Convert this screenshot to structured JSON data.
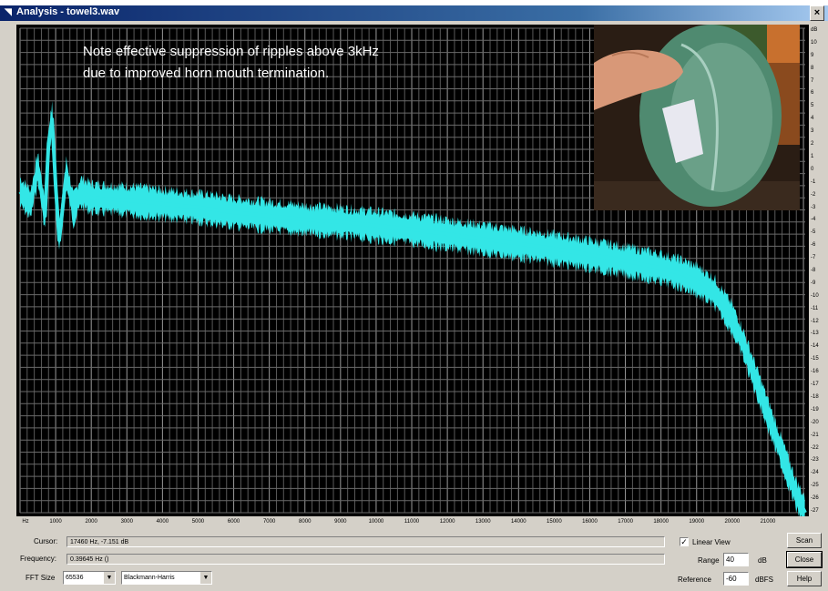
{
  "window": {
    "title": "Analysis - towel3.wav",
    "close_label": "×"
  },
  "annotation": {
    "line1": "Note effective suppression of ripples above 3kHz",
    "line2": "due to improved horn mouth termination."
  },
  "chart_data": {
    "type": "line",
    "xlabel": "",
    "ylabel": "dB",
    "xlim": [
      0,
      22050
    ],
    "ylim": [
      -28,
      12
    ],
    "grid": true,
    "x_ticks": [
      "Hz",
      "1000",
      "2000",
      "3000",
      "4000",
      "5000",
      "6000",
      "7000",
      "8000",
      "9000",
      "10000",
      "11000",
      "12000",
      "13000",
      "14000",
      "15000",
      "16000",
      "17000",
      "18000",
      "19000",
      "20000",
      "21000"
    ],
    "y_ticks": [
      "dB",
      "10",
      "9",
      "8",
      "7",
      "6",
      "5",
      "4",
      "3",
      "2",
      "1",
      "0",
      "-1",
      "-2",
      "-3",
      "-4",
      "-5",
      "-6",
      "-7",
      "-8",
      "-9",
      "-10",
      "-11",
      "-12",
      "-13",
      "-14",
      "-15",
      "-16",
      "-17",
      "-18",
      "-19",
      "-20",
      "-21",
      "-22",
      "-23",
      "-24",
      "-25",
      "-26",
      "-27"
    ],
    "series": [
      {
        "color": "#33e6e6",
        "x": [
          0,
          300,
          500,
          700,
          800,
          900,
          1000,
          1100,
          1300,
          1500,
          1700,
          2000,
          3000,
          4000,
          5000,
          6000,
          7000,
          8000,
          9000,
          10000,
          11000,
          12000,
          13000,
          14000,
          15000,
          16000,
          17000,
          18000,
          18500,
          19000,
          19500,
          20000,
          20300,
          20600,
          20900,
          21200,
          21500,
          21800,
          22050
        ],
        "y": [
          -1.5,
          -2.5,
          0.5,
          -3.5,
          2.5,
          4.5,
          -1.0,
          -5.5,
          0.0,
          -3.0,
          -1.5,
          -2.0,
          -2.2,
          -2.5,
          -2.8,
          -3.2,
          -3.5,
          -3.8,
          -4.0,
          -4.3,
          -4.6,
          -5.0,
          -5.4,
          -5.8,
          -6.2,
          -6.7,
          -7.2,
          -7.8,
          -8.2,
          -8.8,
          -9.8,
          -12.0,
          -14.0,
          -16.5,
          -19.0,
          -21.5,
          -24.0,
          -26.5,
          -28.0
        ]
      }
    ]
  },
  "status": {
    "cursor_label": "Cursor:",
    "cursor_value": "17460 Hz, -7.151 dB",
    "frequency_label": "Frequency:",
    "frequency_value": "0.39645 Hz ()",
    "fft_size_label": "FFT Size",
    "fft_size_value": "65536",
    "window_value": "Blackmann-Harris"
  },
  "options": {
    "linear_view_label": "Linear View",
    "linear_view_checked": "✓",
    "range_label": "Range",
    "range_value": "40",
    "range_unit": "dB",
    "reference_label": "Reference",
    "reference_value": "-60",
    "reference_unit": "dBFS"
  },
  "buttons": {
    "scan": "Scan",
    "close": "Close",
    "help": "Help"
  }
}
